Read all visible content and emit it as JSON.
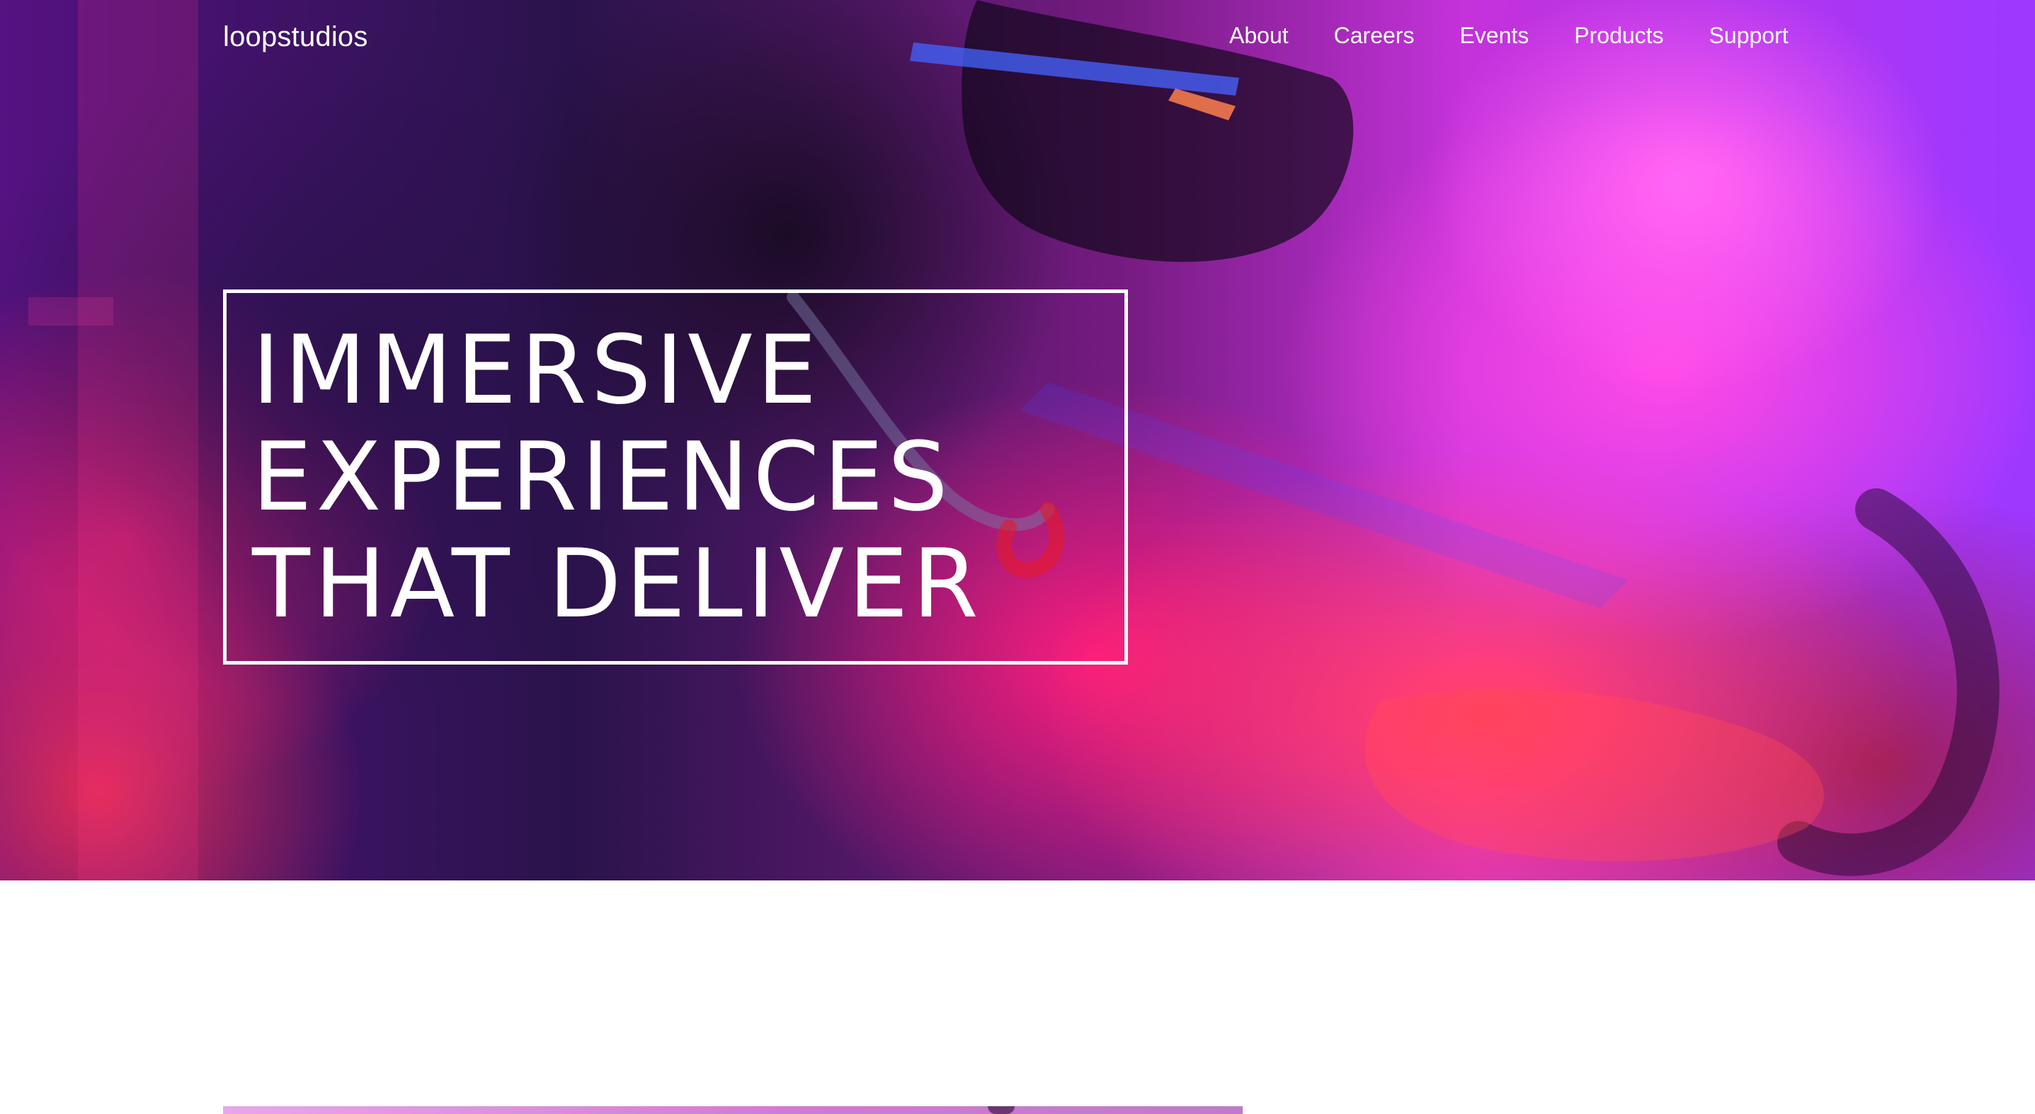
{
  "header": {
    "logo_text": "loopstudios",
    "nav": [
      {
        "label": "About"
      },
      {
        "label": "Careers"
      },
      {
        "label": "Events"
      },
      {
        "label": "Products"
      },
      {
        "label": "Support"
      }
    ]
  },
  "hero": {
    "headline": "IMMERSIVE\nEXPERIENCES\nTHAT DELIVER"
  },
  "colors": {
    "text_on_hero": "#ffffff",
    "page_background": "#ffffff"
  }
}
